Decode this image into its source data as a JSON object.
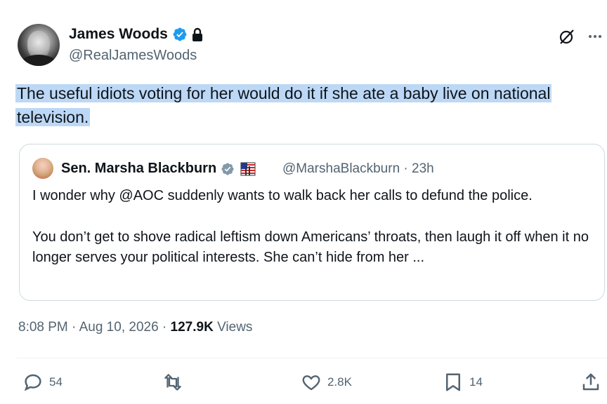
{
  "author": {
    "name": "James Woods",
    "handle": "@RealJamesWoods"
  },
  "tweet": {
    "text": "The useful idiots voting for her would do it if she ate a baby live on national television."
  },
  "quoted_tweet": {
    "name": "Sen. Marsha Blackburn",
    "handle_time": "@MarshaBlackburn · 23h",
    "paragraphs": [
      "I wonder why @AOC suddenly wants to walk back her calls to defund the police.",
      "You don’t get to shove radical leftism down Americans’ throats, then laugh it off when it no longer serves your political interests. She can’t hide from her ..."
    ]
  },
  "meta": {
    "timestamp": "8:08 PM · Aug 10, 2026 · ",
    "views_count": "127.9K",
    "views_label": " Views"
  },
  "actions": {
    "replies": "54",
    "reposts": "",
    "likes": "2.8K",
    "bookmarks": "14"
  },
  "colors": {
    "highlight": "#bcd8f6",
    "verified": "#1d9bf0",
    "muted_text": "#536471"
  },
  "icons": [
    "verified-badge-icon",
    "lock-icon",
    "grok-icon",
    "more-icon",
    "flag-icon",
    "reply-icon",
    "repost-icon",
    "like-icon",
    "bookmark-icon",
    "share-icon"
  ]
}
